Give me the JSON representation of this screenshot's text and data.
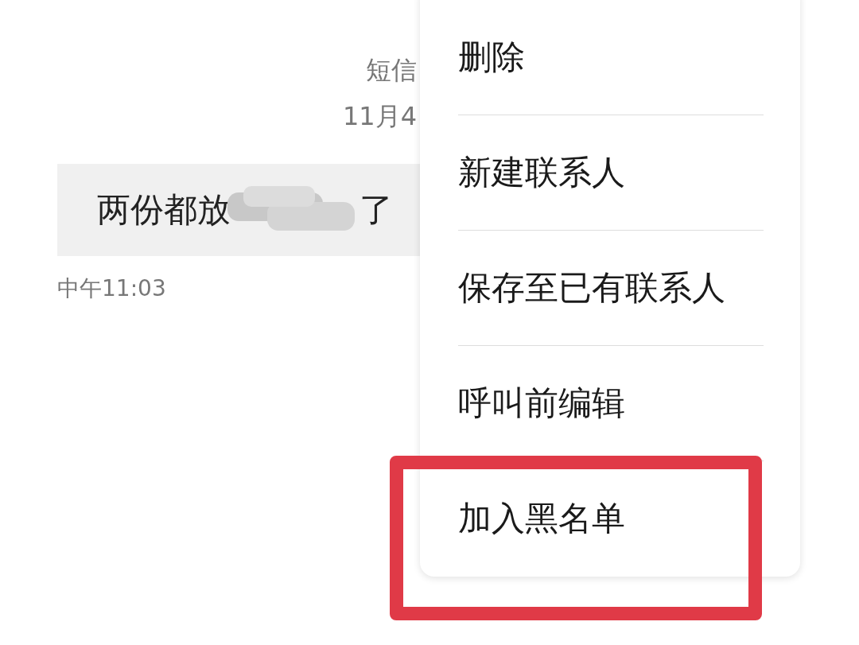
{
  "conversation": {
    "channel_label": "短信",
    "date": "11月4",
    "message": {
      "text_before": "两份都放",
      "redacted": true,
      "text_after": "了",
      "time": "中午11:03"
    }
  },
  "menu": {
    "items": [
      {
        "label": "删除",
        "highlighted": false
      },
      {
        "label": "新建联系人",
        "highlighted": false
      },
      {
        "label": "保存至已有联系人",
        "highlighted": false
      },
      {
        "label": "呼叫前编辑",
        "highlighted": false
      },
      {
        "label": "加入黑名单",
        "highlighted": true
      }
    ]
  }
}
